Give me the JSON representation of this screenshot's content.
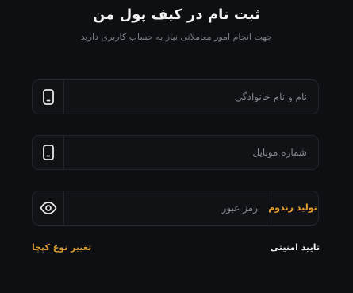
{
  "header": {
    "title": "ثبت نام در کیف پول من",
    "subtitle": "جهت انجام امور معاملاتی نیاز به حساب کاربری دارید"
  },
  "form": {
    "full_name": {
      "placeholder": "نام و نام خانوادگی",
      "icon": "mobile-icon"
    },
    "mobile": {
      "placeholder": "شماره موبایل",
      "icon": "mobile-icon"
    },
    "password": {
      "placeholder": "رمز عبور",
      "icon": "eye-icon",
      "generate_label": "تولید رندوم"
    }
  },
  "captcha": {
    "confirm_label": "تایید امنیتی",
    "change_label": "تغییر نوع کپچا"
  },
  "colors": {
    "background": "#0e0f12",
    "field_bg": "#111216",
    "border": "#23252b",
    "accent": "#e3a12f"
  }
}
